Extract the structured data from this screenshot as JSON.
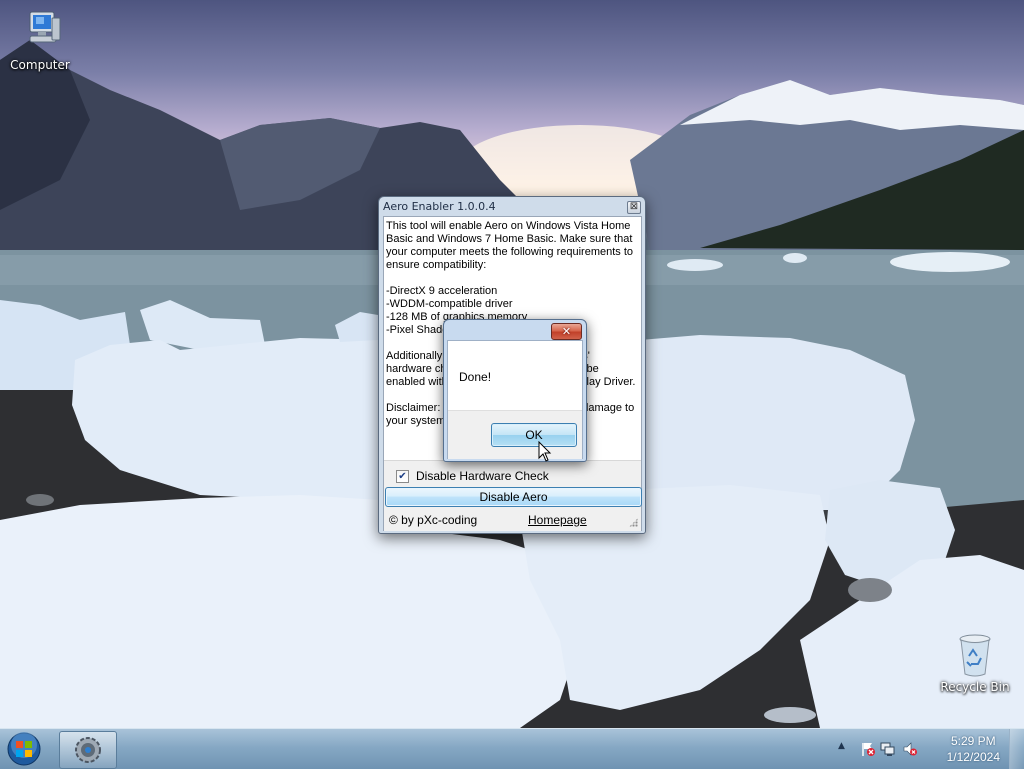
{
  "desktop": {
    "icons": [
      {
        "label": "Computer",
        "icon": "computer-icon"
      },
      {
        "label": "Recycle Bin",
        "icon": "recycle-bin-icon"
      }
    ]
  },
  "main_window": {
    "title": "Aero Enabler 1.0.0.4",
    "close_glyph": "⊠",
    "body_text": "This tool will enable Aero on Windows Vista Home Basic and Windows 7 Home Basic. Make sure that your computer meets the following requirements to ensure compatibility:\n\n-DirectX 9 acceleration\n-WDDM-compatible driver\n-128 MB of graphics memory\n-Pixel Shader 2.0 in hardware support\n\nAdditionally you can disable the Windows' hardware check with this tool. It can also be enabled with the Microsoft Windows Display Driver.\n\nDisclaimer: I am not responsible for any damage to your system.",
    "checkbox": {
      "label": "Disable Hardware Check",
      "checked": true,
      "check_glyph": "✔"
    },
    "action_button": "Disable Aero",
    "credit": "© by pXc-coding",
    "link": "Homepage"
  },
  "message_box": {
    "close_glyph": "✕",
    "message": "Done!",
    "ok_button": "OK"
  },
  "taskbar": {
    "start_icon": "windows-orb-icon",
    "running_app_icon": "gear-app-icon",
    "tray_icons": [
      "show-hidden-icons-chevron-icon",
      "action-center-flag-icon",
      "network-icon",
      "volume-icon"
    ],
    "tray_chevron": "▲",
    "time": "5:29 PM",
    "date": "1/12/2024"
  },
  "colors": {
    "taskbar": "#86a8c4",
    "button_border": "#3c7fb1",
    "close_button_red": "#c2412a"
  }
}
